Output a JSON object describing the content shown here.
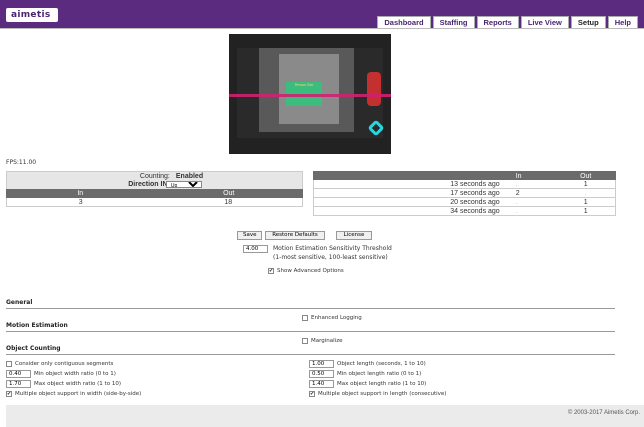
{
  "header": {
    "logo_text": "aimetis",
    "tabs": [
      {
        "label": "Dashboard"
      },
      {
        "label": "Staffing"
      },
      {
        "label": "Reports"
      },
      {
        "label": "Live View"
      },
      {
        "label": "Setup"
      },
      {
        "label": "Help"
      }
    ],
    "active_tab": "Setup"
  },
  "camera": {
    "detection_label": "Person Bar"
  },
  "fps": "FPS:11.00",
  "counting": {
    "counting_label": "Counting:",
    "counting_value": "Enabled",
    "direction_label": "Direction IN:",
    "direction_value": "Up",
    "in_header": "In",
    "out_header": "Out",
    "in_value": "3",
    "out_value": "18"
  },
  "history": {
    "in_header": "In",
    "out_header": "Out",
    "rows": [
      {
        "time": "13 seconds ago",
        "in": ".",
        "out": "1"
      },
      {
        "time": "17 seconds ago",
        "in": "2",
        "out": "."
      },
      {
        "time": "20 seconds ago",
        "in": ".",
        "out": "1"
      },
      {
        "time": "34 seconds ago",
        "in": ".",
        "out": "1"
      }
    ]
  },
  "buttons": {
    "save": "Save",
    "restore": "Restore Defaults",
    "license": "License"
  },
  "sensitivity": {
    "value": "4.00",
    "label1": "Motion Estimation Sensitivity Threshold",
    "label2": "(1-most sensitive, 100-least sensitive)"
  },
  "show_advanced": {
    "label": "Show Advanced Options",
    "checked": true
  },
  "sections": {
    "general": "General",
    "enhanced_logging": {
      "label": "Enhanced Logging",
      "checked": false
    },
    "motion": "Motion Estimation",
    "marginalize": {
      "label": "Marginalize",
      "checked": false
    },
    "object_counting": "Object Counting"
  },
  "object_counting": {
    "contiguous": {
      "label": "Consider only contiguous segments",
      "checked": false
    },
    "min_width": {
      "value": "0.40",
      "label": "Min object width ratio (0 to 1)"
    },
    "max_width": {
      "value": "1.70",
      "label": "Max object width ratio (1 to 10)"
    },
    "multi_width": {
      "label": "Multiple object support in width (side-by-side)",
      "checked": true
    },
    "length": {
      "value": "1.00",
      "label": "Object length (seconds, 1 to 10)"
    },
    "min_length": {
      "value": "0.50",
      "label": "Min object length ratio (0 to 1)"
    },
    "max_length": {
      "value": "1.40",
      "label": "Max object length ratio (1 to 10)"
    },
    "multi_length": {
      "label": "Multiple object support in length (consecutive)",
      "checked": true
    }
  },
  "footer": {
    "copyright": "© 2003-2017 Aimetis Corp."
  },
  "colors": {
    "brand": "#5b2b80",
    "table_header": "#6b6b6b",
    "detection": "#2ec47a",
    "count_line": "#d02070"
  }
}
